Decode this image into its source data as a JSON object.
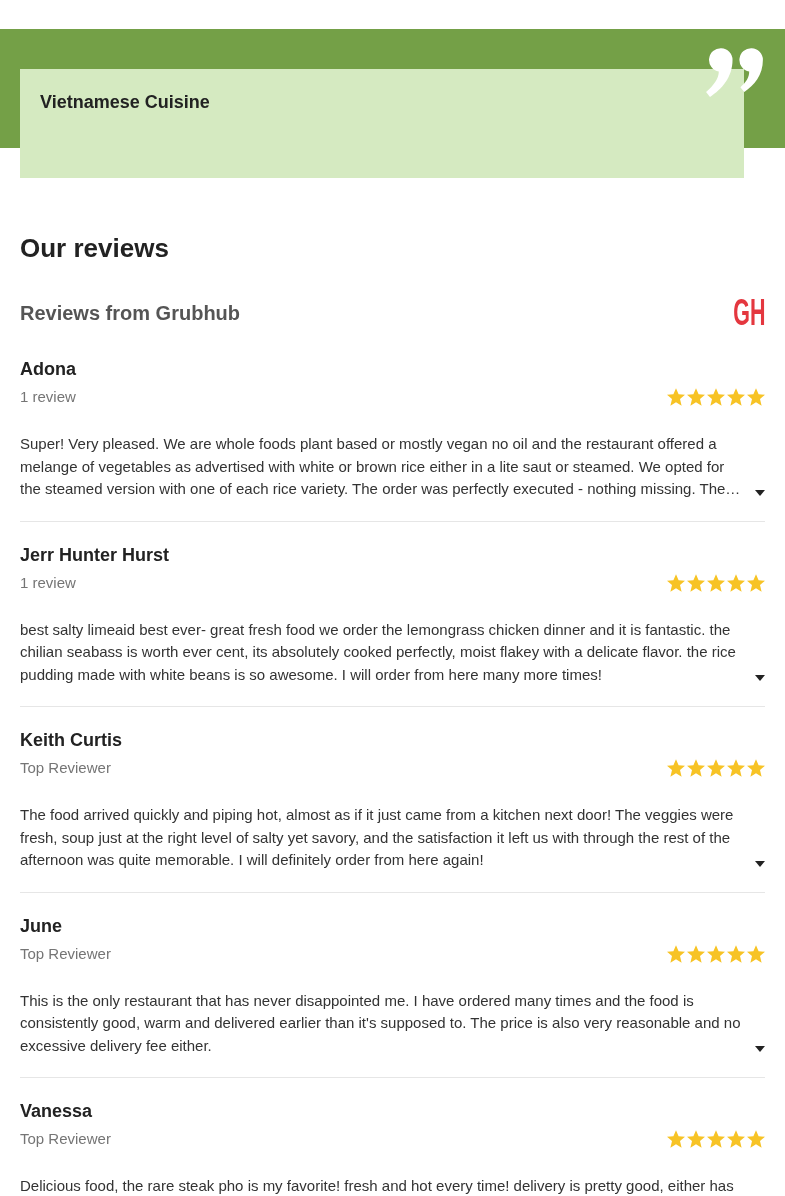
{
  "banner": {
    "title": "Vietnamese Cuisine"
  },
  "section_title": "Our reviews",
  "source": {
    "title": "Reviews from Grubhub",
    "logo": "GH"
  },
  "reviews": [
    {
      "name": "Adona",
      "subtitle": "1 review",
      "stars": 5,
      "text": "Super! Very pleased. We are whole foods plant based or mostly vegan no oil and the restaurant offered a melange of vegetables as advertised with white or brown rice either in a lite saut or steamed. We opted for the steamed version with one of each rice variety. The order was perfectly executed - nothing missing. The…",
      "expanded": false
    },
    {
      "name": "Jerr Hunter Hurst",
      "subtitle": "1 review",
      "stars": 5,
      "text": "best salty limeaid best ever- great fresh food we order the lemongrass chicken dinner and it is fantastic. the chilian seabass is worth ever cent, its absolutely cooked perfectly, moist flakey with a delicate flavor. the rice pudding made with white beans is so awesome. I will order from here many more times!",
      "expanded": false
    },
    {
      "name": "Keith Curtis",
      "subtitle": "Top Reviewer",
      "stars": 5,
      "text": "The food arrived quickly and piping hot, almost as if it just came from a kitchen next door! The veggies were fresh, soup just at the right level of salty yet savory, and the satisfaction it left us with through the rest of the afternoon was quite memorable. I will definitely order from here again!",
      "expanded": false
    },
    {
      "name": "June",
      "subtitle": "Top Reviewer",
      "stars": 5,
      "text": "This is the only restaurant that has never disappointed me. I have ordered many times and the food is consistently good, warm and delivered earlier than it's supposed to. The price is also very reasonable and no excessive delivery fee either.",
      "expanded": false
    },
    {
      "name": "Vanessa",
      "subtitle": "Top Reviewer",
      "stars": 5,
      "text": "Delicious food, the rare steak pho is my favorite! fresh and hot every time! delivery is pretty good, either has"
    }
  ]
}
